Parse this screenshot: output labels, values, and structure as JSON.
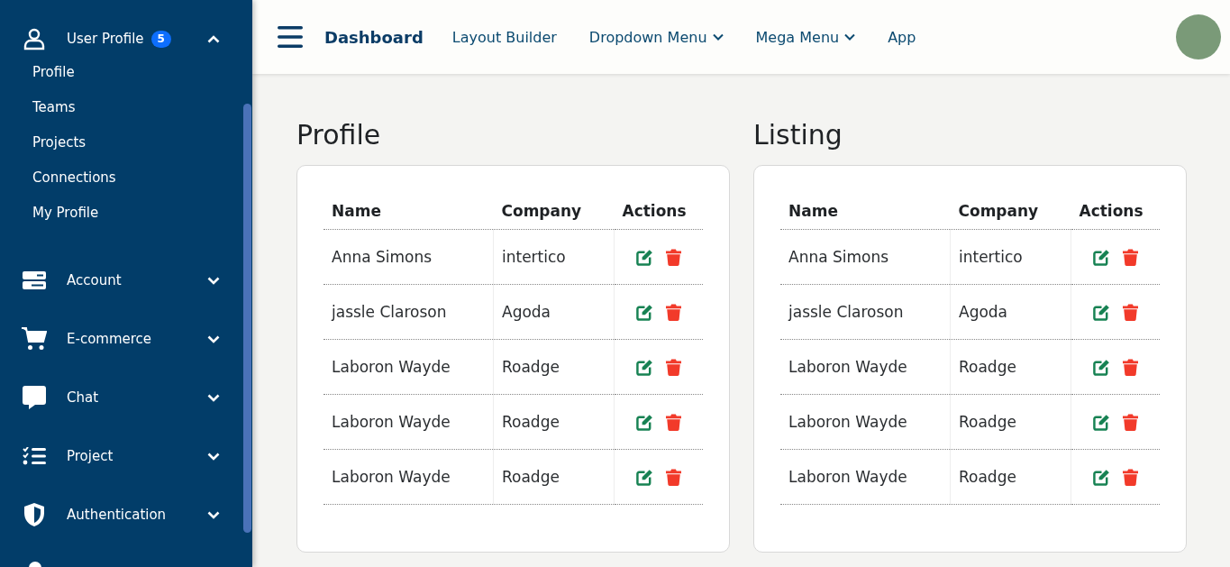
{
  "sidebar": {
    "items": [
      {
        "label": "User Profile",
        "badge": "5",
        "expanded": true,
        "children": [
          {
            "label": "Profile"
          },
          {
            "label": "Teams"
          },
          {
            "label": "Projects"
          },
          {
            "label": "Connections"
          },
          {
            "label": "My Profile"
          }
        ]
      },
      {
        "label": "Account",
        "expanded": false
      },
      {
        "label": "E-commerce",
        "expanded": false
      },
      {
        "label": "Chat",
        "expanded": false
      },
      {
        "label": "Project",
        "expanded": false
      },
      {
        "label": "Authentication",
        "expanded": false
      }
    ]
  },
  "header": {
    "brand": "Dashboard",
    "nav": [
      {
        "label": "Layout Builder",
        "dropdown": false
      },
      {
        "label": "Dropdown Menu",
        "dropdown": true
      },
      {
        "label": "Mega Menu",
        "dropdown": true
      },
      {
        "label": "App",
        "dropdown": false
      }
    ]
  },
  "panels": [
    {
      "title": "Profile",
      "columns": [
        "Name",
        "Company",
        "Actions"
      ],
      "rows": [
        {
          "name": "Anna Simons",
          "company": "intertico"
        },
        {
          "name": "jassle Claroson",
          "company": "Agoda"
        },
        {
          "name": "Laboron Wayde",
          "company": "Roadge"
        },
        {
          "name": "Laboron Wayde",
          "company": "Roadge"
        },
        {
          "name": "Laboron Wayde",
          "company": "Roadge"
        }
      ]
    },
    {
      "title": "Listing",
      "columns": [
        "Name",
        "Company",
        "Actions"
      ],
      "rows": [
        {
          "name": "Anna Simons",
          "company": "intertico"
        },
        {
          "name": "jassle Claroson",
          "company": "Agoda"
        },
        {
          "name": "Laboron Wayde",
          "company": "Roadge"
        },
        {
          "name": "Laboron Wayde",
          "company": "Roadge"
        },
        {
          "name": "Laboron Wayde",
          "company": "Roadge"
        }
      ]
    }
  ]
}
